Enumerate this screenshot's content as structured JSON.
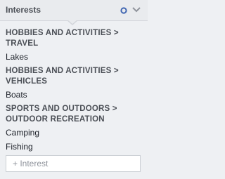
{
  "header": {
    "title": "Interests"
  },
  "groups": [
    {
      "heading": "HOBBIES AND ACTIVITIES > TRAVEL",
      "items": [
        "Lakes"
      ]
    },
    {
      "heading": "HOBBIES AND ACTIVITIES > VEHICLES",
      "items": [
        "Boats"
      ]
    },
    {
      "heading": "SPORTS AND OUTDOORS > OUTDOOR RECREATION",
      "items": [
        "Camping",
        "Fishing"
      ]
    }
  ],
  "add_interest": {
    "label": "+ Interest"
  },
  "colors": {
    "accent": "#4267b2",
    "heading": "#4b4f56",
    "placeholder": "#90949c"
  },
  "icons": {
    "settings": "settings-dot-icon",
    "collapse": "chevron-down-icon"
  }
}
